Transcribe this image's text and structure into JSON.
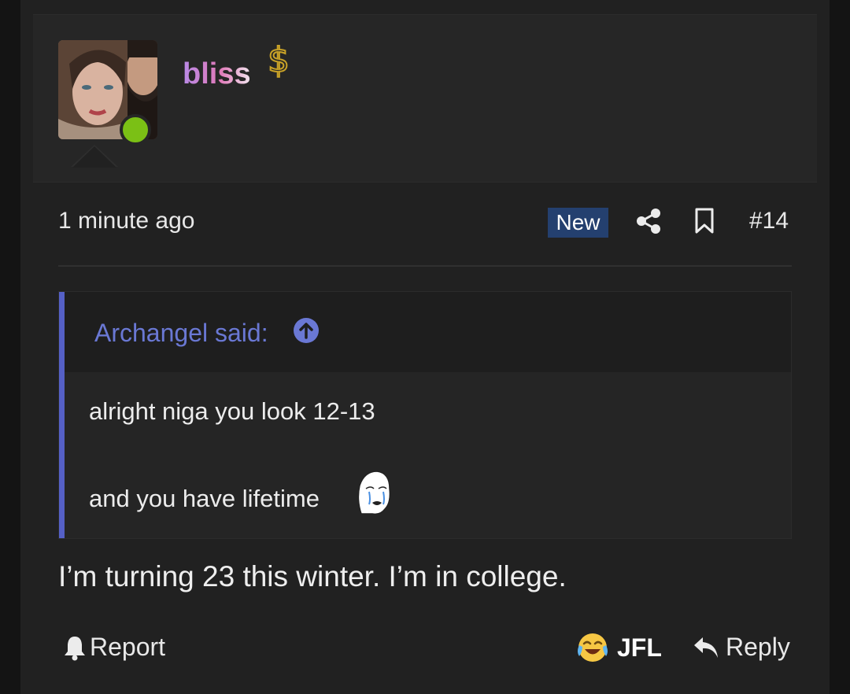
{
  "post": {
    "username": "bliss",
    "timestamp": "1 minute ago",
    "badge_new": "New",
    "post_number": "#14",
    "body": "I’m turning 23 this winter. I’m in college.",
    "colors": {
      "online": "#7bc015",
      "new_badge_bg": "#24406f",
      "quote_accent": "#5560c6",
      "quote_author": "#6a78d4",
      "username_gradient": [
        "#b889e6",
        "#e07ab9",
        "#f2e6ef"
      ]
    },
    "icons": {
      "user_badge": "dollar-sign-icon",
      "share": "share-icon",
      "bookmark": "bookmark-icon",
      "quote_jump": "arrow-up-circle-icon",
      "quote_smiley": "crying-wojak-icon",
      "report": "bell-icon",
      "reaction": "tears-of-joy-emoji-icon",
      "reply": "reply-arrow-icon"
    }
  },
  "quote": {
    "author": "Archangel said:",
    "line1": "alright niga you look 12-13",
    "line2": "and you have lifetime"
  },
  "actions": {
    "report": "Report",
    "reaction": "JFL",
    "reply": "Reply"
  }
}
